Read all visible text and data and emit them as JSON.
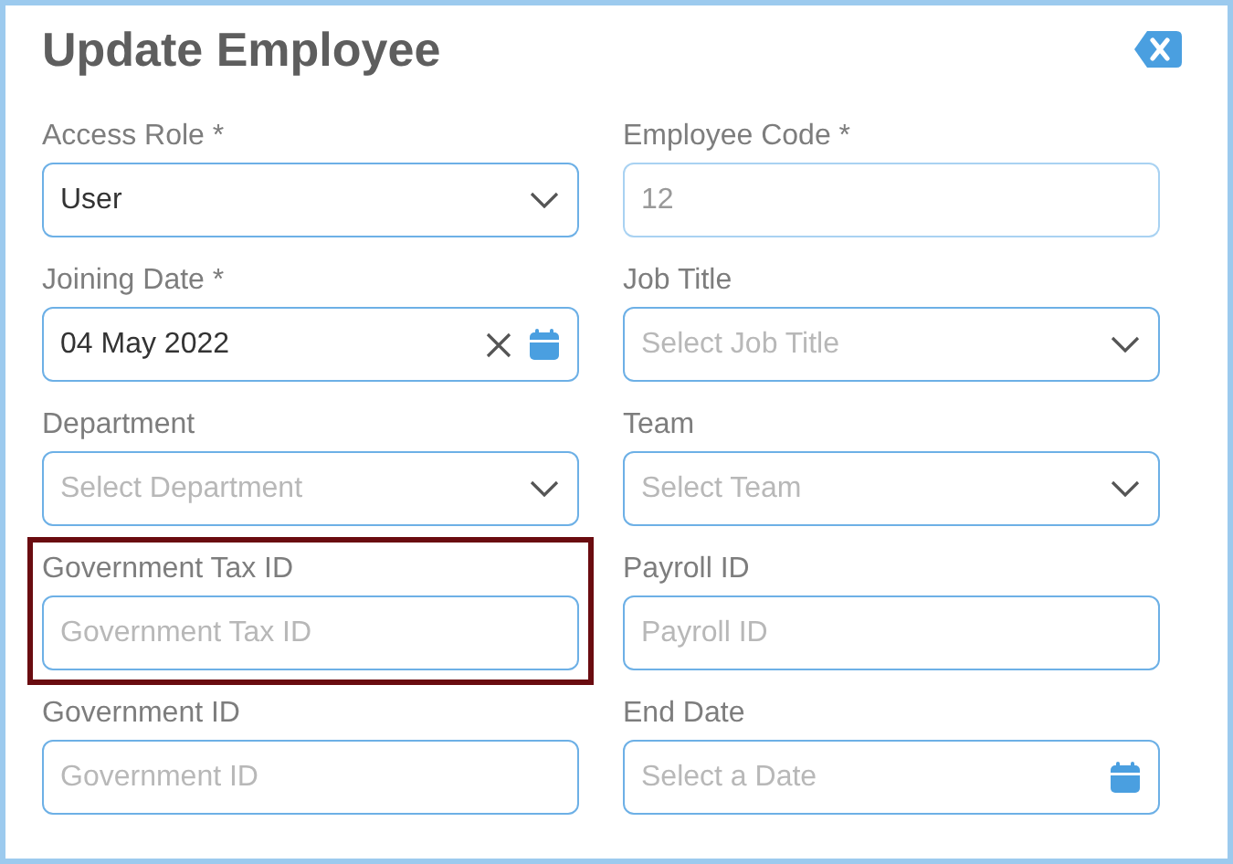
{
  "title": "Update Employee",
  "fields": [
    {
      "label": "Access Role *",
      "kind": "select",
      "value": "User",
      "disabled": false,
      "clearable": false,
      "highlighted": false
    },
    {
      "label": "Employee Code *",
      "kind": "text",
      "value": "12",
      "disabled": true,
      "clearable": false,
      "highlighted": false
    },
    {
      "label": "Joining Date *",
      "kind": "date",
      "value": "04 May 2022",
      "disabled": false,
      "clearable": true,
      "highlighted": false
    },
    {
      "label": "Job Title",
      "kind": "select",
      "placeholder": "Select Job Title",
      "disabled": false,
      "clearable": false,
      "highlighted": false
    },
    {
      "label": "Department",
      "kind": "select",
      "placeholder": "Select Department",
      "disabled": false,
      "clearable": false,
      "highlighted": false
    },
    {
      "label": "Team",
      "kind": "select",
      "placeholder": "Select Team",
      "disabled": false,
      "clearable": false,
      "highlighted": false
    },
    {
      "label": "Government Tax ID",
      "kind": "text",
      "placeholder": "Government Tax ID",
      "disabled": false,
      "clearable": false,
      "highlighted": true
    },
    {
      "label": "Payroll ID",
      "kind": "text",
      "placeholder": "Payroll ID",
      "disabled": false,
      "clearable": false,
      "highlighted": false
    },
    {
      "label": "Government ID",
      "kind": "text",
      "placeholder": "Government ID",
      "disabled": false,
      "clearable": false,
      "highlighted": false
    },
    {
      "label": "End Date",
      "kind": "date",
      "placeholder": "Select a Date",
      "disabled": false,
      "clearable": false,
      "highlighted": false
    }
  ]
}
